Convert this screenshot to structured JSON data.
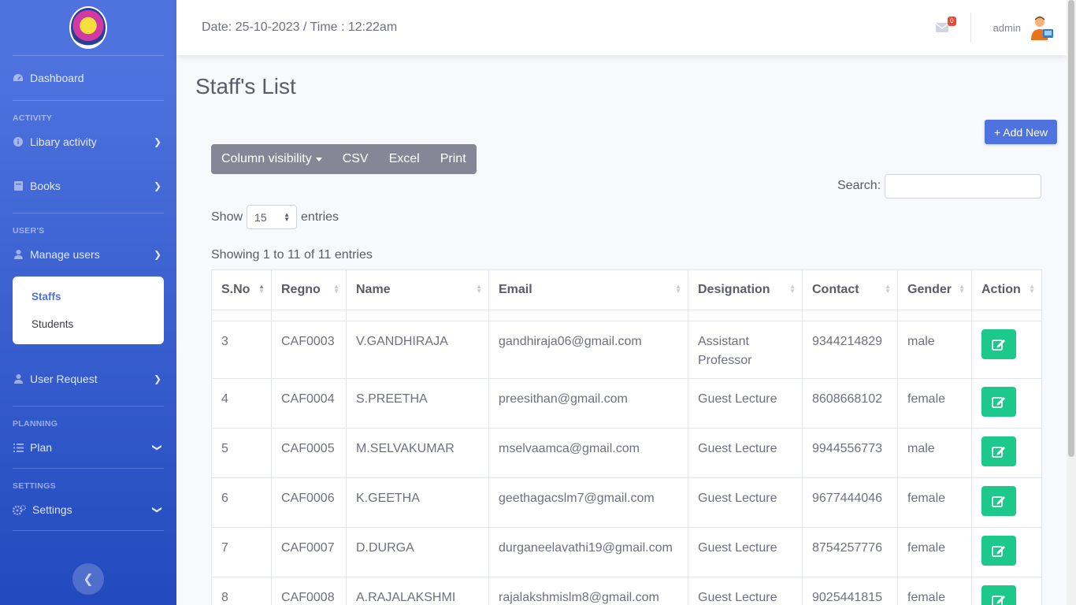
{
  "sidebar": {
    "dashboard": "Dashboard",
    "heading_activity": "ACTIVITY",
    "library_activity": "Libary activity",
    "books": "Books",
    "heading_users": "USER'S",
    "manage_users": "Manage users",
    "sub_staffs": "Staffs",
    "sub_students": "Students",
    "user_request": "User Request",
    "heading_planning": "PLANNING",
    "plan": "Plan",
    "heading_settings": "SETTINGS",
    "settings": "Settings"
  },
  "topbar": {
    "datetime": "Date: 25-10-2023 / Time : 12:22am",
    "mail_count": "0",
    "user": "admin"
  },
  "page": {
    "title": "Staff's List",
    "add_new": "+ Add New",
    "buttons": {
      "colvis": "Column visibility",
      "csv": "CSV",
      "excel": "Excel",
      "print": "Print"
    },
    "search_label": "Search:",
    "show_label": "Show",
    "show_value": "15",
    "entries_label": "entries",
    "info": "Showing 1 to 11 of 11 entries"
  },
  "table": {
    "headers": [
      "S.No",
      "Regno",
      "Name",
      "Email",
      "Designation",
      "Contact",
      "Gender",
      "Action"
    ],
    "rows": [
      [
        "3",
        "CAF0003",
        "V.GANDHIRAJA",
        "gandhiraja06@gmail.com",
        "Assistant Professor",
        "9344214829",
        "male"
      ],
      [
        "4",
        "CAF0004",
        "S.PREETHA",
        "preesithan@gmail.com",
        "Guest Lecture",
        "8608668102",
        "female"
      ],
      [
        "5",
        "CAF0005",
        "M.SELVAKUMAR",
        "mselvaamca@gmail.com",
        "Guest Lecture",
        "9944556773",
        "male"
      ],
      [
        "6",
        "CAF0006",
        "K.GEETHA",
        "geethagacslm7@gmail.com",
        "Guest Lecture",
        "9677444046",
        "female"
      ],
      [
        "7",
        "CAF0007",
        "D.DURGA",
        "durganeelavathi19@gmail.com",
        "Guest Lecture",
        "8754257776",
        "female"
      ],
      [
        "8",
        "CAF0008",
        "A.RAJALAKSHMI",
        "rajalakshmislm8@gmail.com",
        "Guest Lecture",
        "9025441815",
        "female"
      ]
    ]
  },
  "colors": {
    "primary": "#4e73df",
    "success": "#1cc88a",
    "secondary": "#858796",
    "danger": "#e74a3b"
  }
}
